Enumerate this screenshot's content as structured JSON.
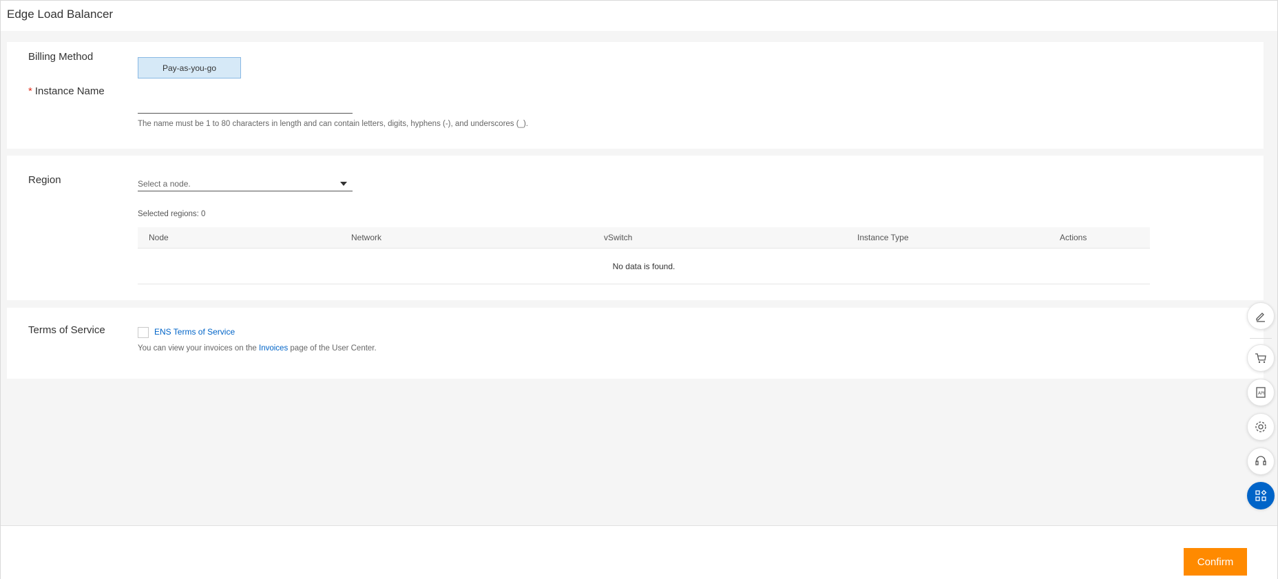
{
  "header": {
    "title": "Edge Load Balancer"
  },
  "billing": {
    "label": "Billing Method",
    "option": "Pay-as-you-go"
  },
  "instance_name": {
    "required_mark": "*",
    "label": "Instance Name",
    "value": "",
    "hint": "The name must be 1 to 80 characters in length and can contain letters, digits, hyphens (-), and underscores (_)."
  },
  "region": {
    "label": "Region",
    "placeholder": "Select a node.",
    "selected_count": "Selected regions: 0",
    "table": {
      "columns": [
        "Node",
        "Network",
        "vSwitch",
        "Instance Type",
        "Actions"
      ],
      "empty_text": "No data is found."
    }
  },
  "terms": {
    "label": "Terms of Service",
    "checkbox_label": "ENS Terms of Service",
    "checked": false,
    "note_prefix": "You can view your invoices on the ",
    "note_link": "Invoices",
    "note_suffix": " page of the User Center."
  },
  "footer": {
    "confirm_label": "Confirm"
  },
  "float_toolbar": [
    "edit-icon",
    "cart-icon",
    "api-icon",
    "settings-icon",
    "support-icon",
    "apps-icon"
  ],
  "colors": {
    "accent": "#0064c8",
    "confirm": "#ff8a00",
    "required": "#e0301e"
  }
}
